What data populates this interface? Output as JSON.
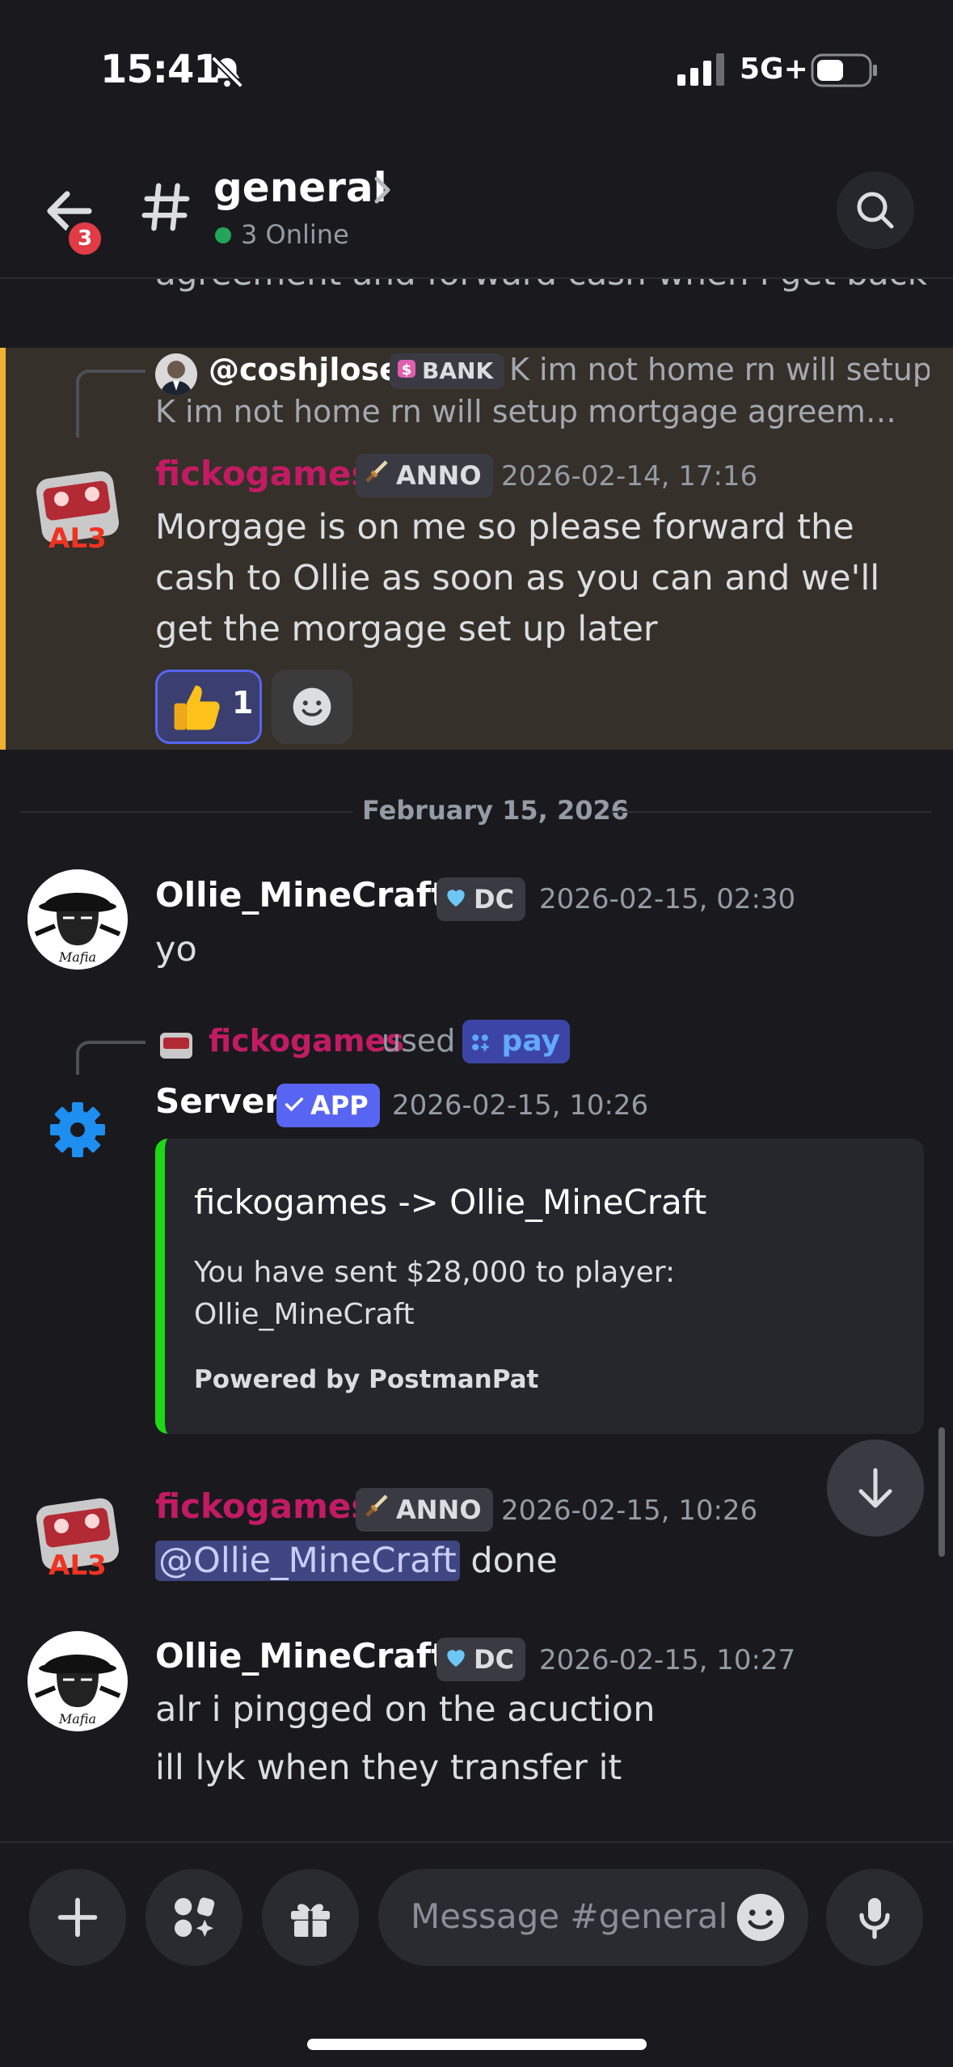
{
  "status": {
    "time": "15:41",
    "network": "5G+"
  },
  "header": {
    "back_badge": "3",
    "channel": "general",
    "online": "3 Online"
  },
  "chat": {
    "cut_text": "agreement and forward cash when i get back",
    "msg1": {
      "reply_name": "@coshjlose",
      "reply_tag": "BANK",
      "reply_text": "K im not home rn will setup mortgage agreement and forward cash when i get ...",
      "author": "fickogames",
      "tag": "ANNO",
      "time": "2026-02-14, 17:16",
      "text": "Morgage is on me so please forward the cash to Ollie as soon as you can and we'll get the morgage set up later",
      "reaction_count": "1"
    },
    "divider": "February 15, 2026",
    "msg2": {
      "author": "Ollie_MineCraft",
      "tag": "DC",
      "time": "2026-02-15, 02:30",
      "text": "yo"
    },
    "msg3": {
      "used_name": "fickogames",
      "used_word": "used",
      "command": "pay",
      "author": "Server",
      "tag": "APP",
      "time": "2026-02-15, 10:26",
      "embed_title": "fickogames -> Ollie_MineCraft",
      "embed_desc": "You have sent $28,000 to player: Ollie_MineCraft",
      "embed_footer": "Powered by PostmanPat"
    },
    "msg4": {
      "author": "fickogames",
      "tag": "ANNO",
      "time": "2026-02-15, 10:26",
      "mention": "@Ollie_MineCraft",
      "text": " done"
    },
    "msg5": {
      "author": "Ollie_MineCraft",
      "tag": "DC",
      "time": "2026-02-15, 10:27",
      "line1": "alr i pingged on the acuction",
      "line2": "ill lyk when they transfer it"
    }
  },
  "composer": {
    "placeholder": "Message #general"
  },
  "colors": {
    "accent": "#5865f2",
    "author_pink": "#c21b63",
    "highlight": "#f0b232",
    "embed_border": "#1ed816"
  },
  "icons": [
    "bell-slash-icon",
    "signal-icon",
    "battery-icon",
    "back-arrow-icon",
    "hash-icon",
    "chevron-right-icon",
    "search-icon",
    "thumbs-up-icon",
    "add-reaction-icon",
    "gear-icon",
    "arrow-down-icon",
    "plus-icon",
    "apps-icon",
    "gift-icon",
    "emoji-icon",
    "mic-icon"
  ]
}
